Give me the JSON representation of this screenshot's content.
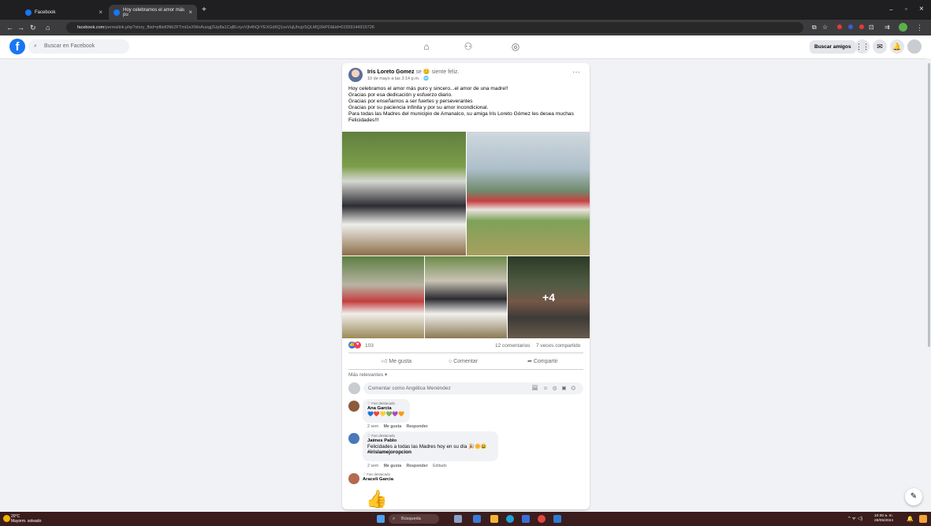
{
  "browser": {
    "tabs": [
      {
        "title": "Facebook",
        "active": false
      },
      {
        "title": "Hoy celebramos el amor más pu",
        "active": true
      }
    ],
    "new_tab": "+",
    "url_domain": "facebook.com",
    "url_path": "/permalink.php?story_fbid=pfbid0Nb2FTmt1eXWoAuogj2Up8a1CqBLnyvVjh4hQrYEXGd6Q1svVujUhvjzSQLMQXkPDl&id=61559144915726",
    "window_controls": [
      "−",
      "▫",
      "×"
    ]
  },
  "fb_header": {
    "logo": "f",
    "search_placeholder": "Buscar en Facebook",
    "find_friends": "Buscar amigos",
    "nav_icons": [
      "home-icon",
      "friends-icon",
      "groups-icon"
    ]
  },
  "post": {
    "author": "Iris Loreto Gomez",
    "feeling": "se 😊 siente feliz.",
    "date": "10 de mayo a las 3:14 p.m. · 🌐",
    "more": "···",
    "text_lines": [
      "Hoy celebramos el amor más puro y sincero...el amor de una madre!!",
      "Gracias por esa dedicación y esfuerzo diario.",
      "Gracias por enseñarnos a ser fuertes y perseverantes",
      "Gracias por su paciencia infinita y por su amor incondicional.",
      "Para todas las Madres del municipio de Amanalco, su amiga Iris Loreto Gómez les desea muchas Felicidades!!!"
    ],
    "more_photos": "+4",
    "reaction_count": "103",
    "comments_count": "12 comentarios",
    "shares_count": "7 veces compartido",
    "actions": {
      "like": "Me gusta",
      "comment": "Comentar",
      "share": "Compartir"
    },
    "sort_label": "Más relevantes ▾",
    "comment_placeholder": "Comentar como Angélica Menéndez",
    "comment_tools": "🖼 ☺ ◎ ▣ ⌬"
  },
  "comments": [
    {
      "badge": "♡ Fan destacado",
      "name": "Ana Garcia",
      "text": "💙❤️💛💚💜🧡",
      "time": "2 sem",
      "like": "Me gusta",
      "reply": "Responder",
      "edited": ""
    },
    {
      "badge": "♡ Fan destacado",
      "name": "Jaimes Pablo",
      "text": "Felicidades a todas las Madres hoy en su día 🎉🌼😃",
      "tag": "#irislamejoropcion",
      "time": "2 sem",
      "like": "Me gusta",
      "reply": "Responder",
      "edited": "Editado"
    },
    {
      "badge": "♡ Fan destacado",
      "name": "Araceli Garcia",
      "text": "👍"
    }
  ],
  "taskbar": {
    "weather_temp": "20°C",
    "weather_desc": "Mayorm. soleado",
    "search": "Búsqueda",
    "time": "10:30 a. m.",
    "date": "28/05/2024",
    "tray": "^ ᯤ ◁)"
  },
  "colors": {
    "fb_blue": "#1877f2",
    "page_bg": "#f0f2f5",
    "chrome_dark": "#1f1f22"
  }
}
